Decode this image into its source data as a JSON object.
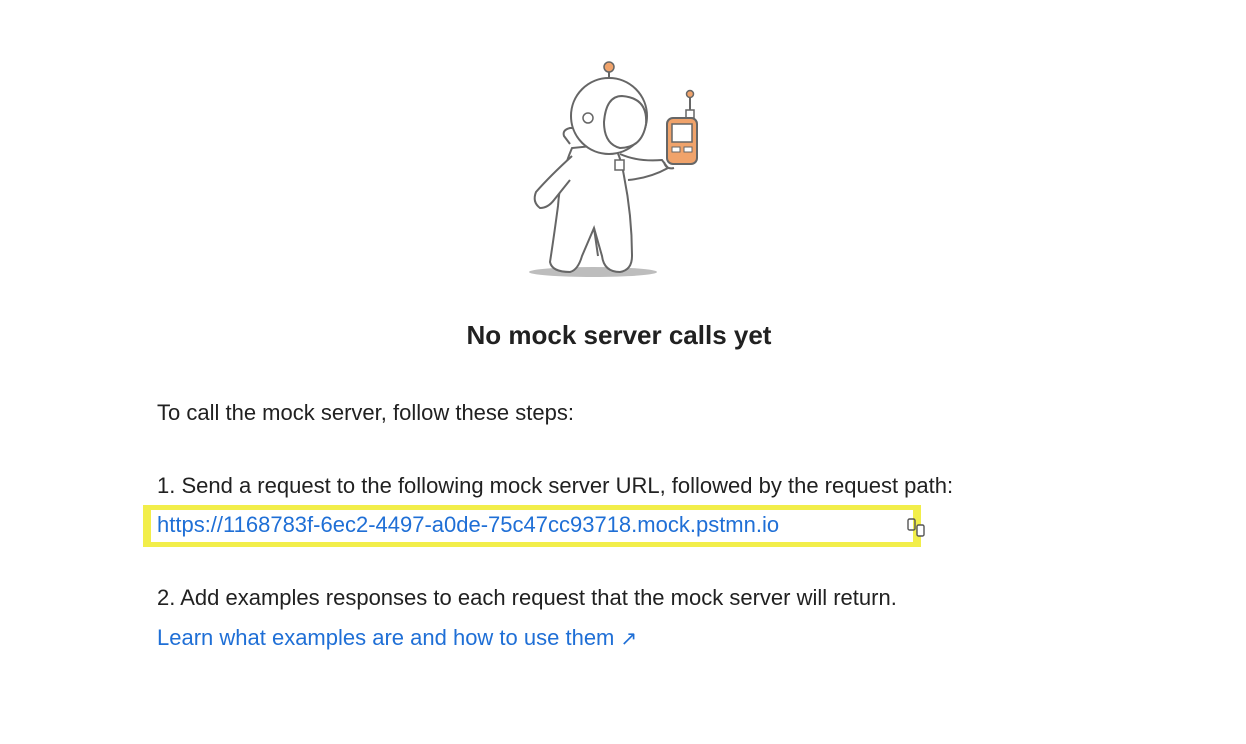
{
  "empty_state": {
    "title": "No mock server calls yet",
    "intro": "To call the mock server, follow these steps:",
    "step1": "1. Send a request to the following mock server URL, followed by the request path:",
    "mock_url": "https://1168783f-6ec2-4497-a0de-75c47cc93718.mock.pstmn.io",
    "step2": "2. Add examples responses to each request that the mock server will return.",
    "learn_link": "Learn what examples are and how to use them",
    "learn_link_arrow": "↗"
  },
  "icons": {
    "illustration": "astronaut-with-walkie-talkie",
    "copy": "copy-icon",
    "external": "external-link-arrow-icon"
  },
  "colors": {
    "link": "#1f6fd6",
    "highlight": "#f2ee4a",
    "accent_orange": "#f0a36b",
    "text": "#212121"
  }
}
